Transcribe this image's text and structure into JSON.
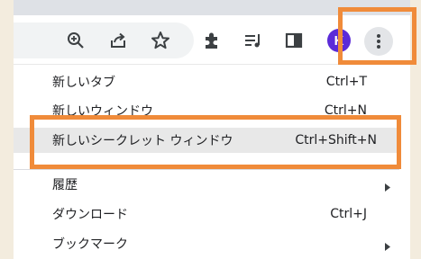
{
  "toolbar": {
    "icons": [
      "zoom-icon",
      "share-icon",
      "bookmark-star-icon",
      "extensions-icon",
      "reading-list-icon",
      "side-panel-icon"
    ],
    "avatar_letter": "K",
    "menu_button": "more-options-icon"
  },
  "menu": {
    "items": [
      {
        "label": "新しいタブ",
        "shortcut": "Ctrl+T"
      },
      {
        "label": "新しいウィンドウ",
        "shortcut": "Ctrl+N"
      },
      {
        "label": "新しいシークレット ウィンドウ",
        "shortcut": "Ctrl+Shift+N"
      },
      {
        "label": "履歴",
        "shortcut": ""
      },
      {
        "label": "ダウンロード",
        "shortcut": "Ctrl+J"
      },
      {
        "label": "ブックマーク",
        "shortcut": ""
      }
    ]
  },
  "colors": {
    "highlight_box": "#f08b3a",
    "avatar": "#5b2bd8",
    "background": "#f3ecde"
  }
}
